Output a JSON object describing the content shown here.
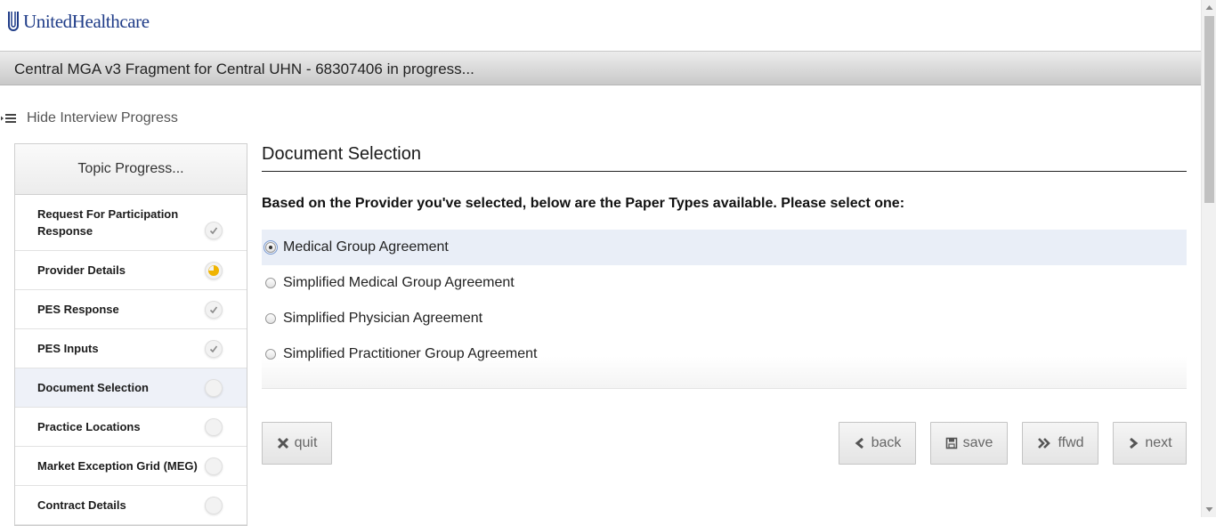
{
  "brand": {
    "name": "UnitedHealthcare"
  },
  "titlebar": {
    "text": "Central MGA v3 Fragment for Central UHN - 68307406 in progress..."
  },
  "progress_toggle": {
    "label": "Hide Interview Progress"
  },
  "sidebar": {
    "header": "Topic Progress...",
    "items": [
      {
        "label": "Request For Participation Response",
        "status": "complete"
      },
      {
        "label": "Provider Details",
        "status": "in-progress"
      },
      {
        "label": "PES Response",
        "status": "complete"
      },
      {
        "label": "PES Inputs",
        "status": "complete"
      },
      {
        "label": "Document Selection",
        "status": "not-started",
        "active": true
      },
      {
        "label": "Practice Locations",
        "status": "not-started"
      },
      {
        "label": "Market Exception Grid (MEG)",
        "status": "not-started"
      },
      {
        "label": "Contract Details",
        "status": "not-started"
      }
    ]
  },
  "main": {
    "title": "Document Selection",
    "instruction": "Based on the Provider you've selected, below are the Paper Types available. Please select one:",
    "options": [
      {
        "label": "Medical Group Agreement",
        "selected": true
      },
      {
        "label": "Simplified Medical Group Agreement",
        "selected": false
      },
      {
        "label": "Simplified Physician Agreement",
        "selected": false
      },
      {
        "label": "Simplified Practitioner Group Agreement",
        "selected": false
      }
    ]
  },
  "buttons": {
    "quit": "quit",
    "back": "back",
    "save": "save",
    "ffwd": "ffwd",
    "next": "next"
  },
  "colors": {
    "brand": "#1f3c88",
    "in_progress": "#f0b400",
    "active_row": "#eef1f8",
    "selected_option": "#e9eef7"
  }
}
